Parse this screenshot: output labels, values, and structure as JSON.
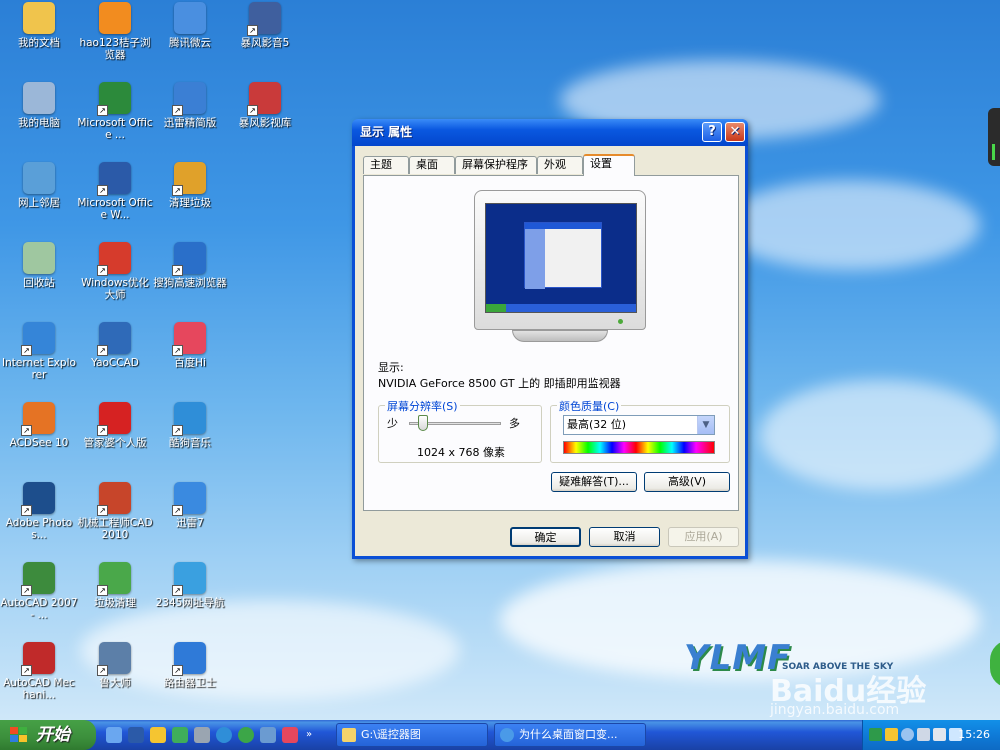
{
  "desktop": {
    "icons": [
      {
        "label": "我的文档",
        "color": "#f0c44c"
      },
      {
        "label": "hao123桔子浏览器",
        "color": "#f28c1f"
      },
      {
        "label": "腾讯微云",
        "color": "#4a8fe0"
      },
      {
        "label": "暴风影音5",
        "color": "#3f5f9e"
      },
      {
        "label": "我的电脑",
        "color": "#9bb7d8"
      },
      {
        "label": "Microsoft Office ...",
        "color": "#2c8a3b"
      },
      {
        "label": "迅雷精简版",
        "color": "#3b7fd4"
      },
      {
        "label": "暴风影视库",
        "color": "#c93a3a"
      },
      {
        "label": "网上邻居",
        "color": "#5a9fd8"
      },
      {
        "label": "Microsoft Office W...",
        "color": "#2b5aa8"
      },
      {
        "label": "清理垃圾",
        "color": "#e0a12a"
      },
      {
        "label": "回收站",
        "color": "#9fc7a0"
      },
      {
        "label": "Windows优化大师",
        "color": "#d63b2c"
      },
      {
        "label": "搜狗高速浏览器",
        "color": "#2a6fc9"
      },
      {
        "label": "Internet Explorer",
        "color": "#3585d8"
      },
      {
        "label": "YaoCCAD",
        "color": "#2f6ab8"
      },
      {
        "label": "百度Hi",
        "color": "#e6475d"
      },
      {
        "label": "ACDSee 10",
        "color": "#e57324"
      },
      {
        "label": "管家婆个人版",
        "color": "#d62222"
      },
      {
        "label": "酷狗音乐",
        "color": "#2f8ed8"
      },
      {
        "label": "Adobe Photos...",
        "color": "#1d4e8c"
      },
      {
        "label": "机械工程师CAD2010",
        "color": "#c7452a"
      },
      {
        "label": "迅雷7",
        "color": "#3a8ae0"
      },
      {
        "label": "AutoCAD 2007 - ...",
        "color": "#3d8b3d"
      },
      {
        "label": "垃圾清理",
        "color": "#4aa84a"
      },
      {
        "label": "2345网址导航",
        "color": "#3aa0e0"
      },
      {
        "label": "AutoCAD Mechani...",
        "color": "#c02a2a"
      },
      {
        "label": "鲁大师",
        "color": "#5c7fa8"
      },
      {
        "label": "路由器卫士",
        "color": "#2f7ad8"
      }
    ]
  },
  "dialog": {
    "title": "显示 属性",
    "help_glyph": "?",
    "close_glyph": "✕",
    "tabs": [
      "主题",
      "桌面",
      "屏幕保护程序",
      "外观",
      "设置"
    ],
    "active_tab": "设置",
    "display_label": "显示:",
    "display_value": "NVIDIA GeForce 8500 GT 上的 即插即用监视器",
    "resolution": {
      "legend": "屏幕分辨率(S)",
      "less": "少",
      "more": "多",
      "value": "1024 x 768 像素",
      "level": 0.15
    },
    "color": {
      "legend": "颜色质量(C)",
      "selected": "最高(32 位)",
      "dd_glyph": "▼"
    },
    "troubleshoot_label": "疑难解答(T)...",
    "advanced_label": "高级(V)",
    "ok_label": "确定",
    "cancel_label": "取消",
    "apply_label": "应用(A)"
  },
  "taskbar": {
    "start_label": "开始",
    "tasks": [
      "G:\\遥控器图",
      "为什么桌面窗口变..."
    ],
    "clock": "15:26"
  },
  "watermark": {
    "brand": "YLMF",
    "slogan": "SOAR ABOVE THE SKY",
    "baidu": "Baidu经验",
    "site": "jingyan.baidu.com"
  }
}
